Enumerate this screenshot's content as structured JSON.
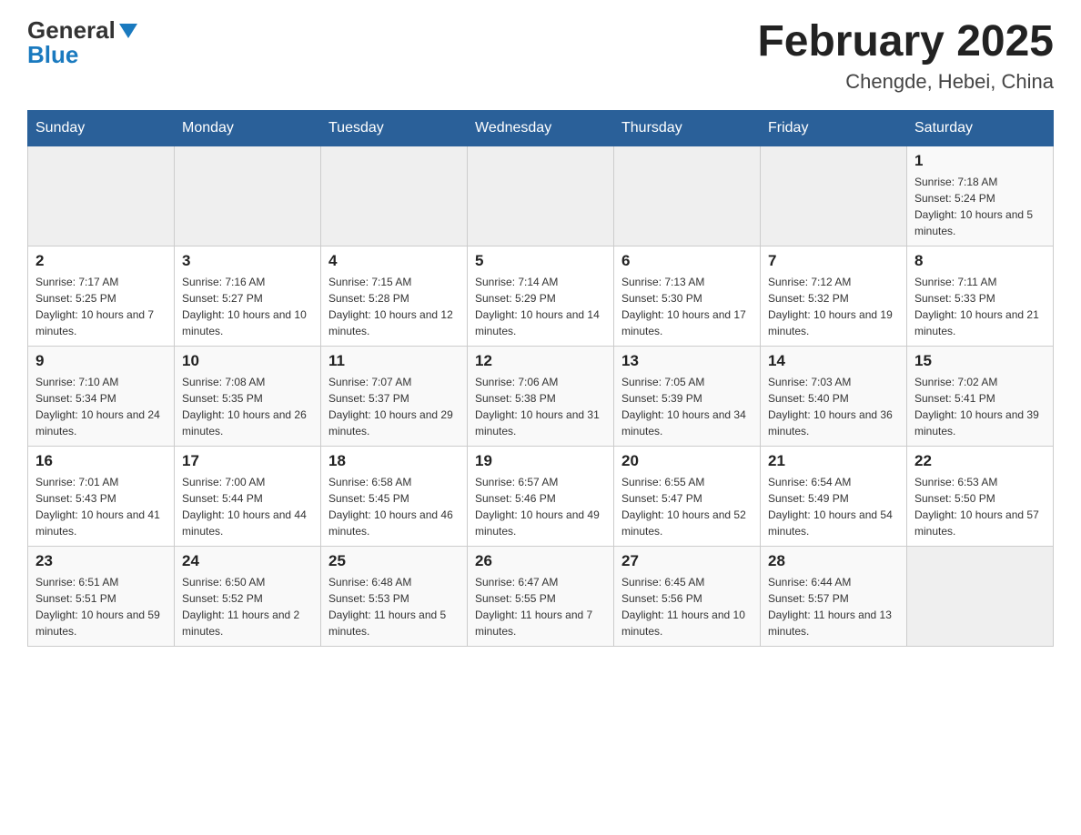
{
  "header": {
    "logo_general": "General",
    "logo_blue": "Blue",
    "month_title": "February 2025",
    "subtitle": "Chengde, Hebei, China"
  },
  "days_of_week": [
    "Sunday",
    "Monday",
    "Tuesday",
    "Wednesday",
    "Thursday",
    "Friday",
    "Saturday"
  ],
  "weeks": [
    [
      {
        "empty": true
      },
      {
        "empty": true
      },
      {
        "empty": true
      },
      {
        "empty": true
      },
      {
        "empty": true
      },
      {
        "empty": true
      },
      {
        "day": "1",
        "sunrise": "Sunrise: 7:18 AM",
        "sunset": "Sunset: 5:24 PM",
        "daylight": "Daylight: 10 hours and 5 minutes."
      }
    ],
    [
      {
        "day": "2",
        "sunrise": "Sunrise: 7:17 AM",
        "sunset": "Sunset: 5:25 PM",
        "daylight": "Daylight: 10 hours and 7 minutes."
      },
      {
        "day": "3",
        "sunrise": "Sunrise: 7:16 AM",
        "sunset": "Sunset: 5:27 PM",
        "daylight": "Daylight: 10 hours and 10 minutes."
      },
      {
        "day": "4",
        "sunrise": "Sunrise: 7:15 AM",
        "sunset": "Sunset: 5:28 PM",
        "daylight": "Daylight: 10 hours and 12 minutes."
      },
      {
        "day": "5",
        "sunrise": "Sunrise: 7:14 AM",
        "sunset": "Sunset: 5:29 PM",
        "daylight": "Daylight: 10 hours and 14 minutes."
      },
      {
        "day": "6",
        "sunrise": "Sunrise: 7:13 AM",
        "sunset": "Sunset: 5:30 PM",
        "daylight": "Daylight: 10 hours and 17 minutes."
      },
      {
        "day": "7",
        "sunrise": "Sunrise: 7:12 AM",
        "sunset": "Sunset: 5:32 PM",
        "daylight": "Daylight: 10 hours and 19 minutes."
      },
      {
        "day": "8",
        "sunrise": "Sunrise: 7:11 AM",
        "sunset": "Sunset: 5:33 PM",
        "daylight": "Daylight: 10 hours and 21 minutes."
      }
    ],
    [
      {
        "day": "9",
        "sunrise": "Sunrise: 7:10 AM",
        "sunset": "Sunset: 5:34 PM",
        "daylight": "Daylight: 10 hours and 24 minutes."
      },
      {
        "day": "10",
        "sunrise": "Sunrise: 7:08 AM",
        "sunset": "Sunset: 5:35 PM",
        "daylight": "Daylight: 10 hours and 26 minutes."
      },
      {
        "day": "11",
        "sunrise": "Sunrise: 7:07 AM",
        "sunset": "Sunset: 5:37 PM",
        "daylight": "Daylight: 10 hours and 29 minutes."
      },
      {
        "day": "12",
        "sunrise": "Sunrise: 7:06 AM",
        "sunset": "Sunset: 5:38 PM",
        "daylight": "Daylight: 10 hours and 31 minutes."
      },
      {
        "day": "13",
        "sunrise": "Sunrise: 7:05 AM",
        "sunset": "Sunset: 5:39 PM",
        "daylight": "Daylight: 10 hours and 34 minutes."
      },
      {
        "day": "14",
        "sunrise": "Sunrise: 7:03 AM",
        "sunset": "Sunset: 5:40 PM",
        "daylight": "Daylight: 10 hours and 36 minutes."
      },
      {
        "day": "15",
        "sunrise": "Sunrise: 7:02 AM",
        "sunset": "Sunset: 5:41 PM",
        "daylight": "Daylight: 10 hours and 39 minutes."
      }
    ],
    [
      {
        "day": "16",
        "sunrise": "Sunrise: 7:01 AM",
        "sunset": "Sunset: 5:43 PM",
        "daylight": "Daylight: 10 hours and 41 minutes."
      },
      {
        "day": "17",
        "sunrise": "Sunrise: 7:00 AM",
        "sunset": "Sunset: 5:44 PM",
        "daylight": "Daylight: 10 hours and 44 minutes."
      },
      {
        "day": "18",
        "sunrise": "Sunrise: 6:58 AM",
        "sunset": "Sunset: 5:45 PM",
        "daylight": "Daylight: 10 hours and 46 minutes."
      },
      {
        "day": "19",
        "sunrise": "Sunrise: 6:57 AM",
        "sunset": "Sunset: 5:46 PM",
        "daylight": "Daylight: 10 hours and 49 minutes."
      },
      {
        "day": "20",
        "sunrise": "Sunrise: 6:55 AM",
        "sunset": "Sunset: 5:47 PM",
        "daylight": "Daylight: 10 hours and 52 minutes."
      },
      {
        "day": "21",
        "sunrise": "Sunrise: 6:54 AM",
        "sunset": "Sunset: 5:49 PM",
        "daylight": "Daylight: 10 hours and 54 minutes."
      },
      {
        "day": "22",
        "sunrise": "Sunrise: 6:53 AM",
        "sunset": "Sunset: 5:50 PM",
        "daylight": "Daylight: 10 hours and 57 minutes."
      }
    ],
    [
      {
        "day": "23",
        "sunrise": "Sunrise: 6:51 AM",
        "sunset": "Sunset: 5:51 PM",
        "daylight": "Daylight: 10 hours and 59 minutes."
      },
      {
        "day": "24",
        "sunrise": "Sunrise: 6:50 AM",
        "sunset": "Sunset: 5:52 PM",
        "daylight": "Daylight: 11 hours and 2 minutes."
      },
      {
        "day": "25",
        "sunrise": "Sunrise: 6:48 AM",
        "sunset": "Sunset: 5:53 PM",
        "daylight": "Daylight: 11 hours and 5 minutes."
      },
      {
        "day": "26",
        "sunrise": "Sunrise: 6:47 AM",
        "sunset": "Sunset: 5:55 PM",
        "daylight": "Daylight: 11 hours and 7 minutes."
      },
      {
        "day": "27",
        "sunrise": "Sunrise: 6:45 AM",
        "sunset": "Sunset: 5:56 PM",
        "daylight": "Daylight: 11 hours and 10 minutes."
      },
      {
        "day": "28",
        "sunrise": "Sunrise: 6:44 AM",
        "sunset": "Sunset: 5:57 PM",
        "daylight": "Daylight: 11 hours and 13 minutes."
      },
      {
        "empty": true
      }
    ]
  ]
}
